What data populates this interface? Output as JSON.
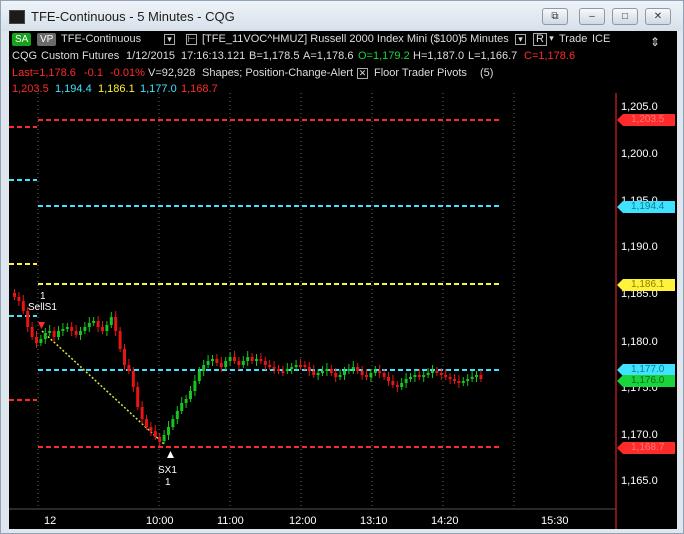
{
  "window": {
    "title": "TFE-Continuous - 5 Minutes - CQG",
    "buttons": [
      "⧉",
      "–",
      "□",
      "✕"
    ]
  },
  "toolbar": {
    "sa": "SA",
    "vp": "VP",
    "symbol": "TFE-Continuous",
    "contract": "[TFE_11VOC^HMUZ] Russell 2000 Index Mini ($100)",
    "interval": "5 Minutes",
    "r_button": "R",
    "trade": "Trade",
    "exchange": "ICE"
  },
  "quote": {
    "source": "CQG",
    "account": "Custom Futures",
    "date": "1/12/2015",
    "time": "17:16:13.121",
    "bid": "B=1,178.5",
    "ask": "A=1,178.6",
    "open": "O=1,179.2",
    "high": "H=1,187.0",
    "low": "L=1,166.7",
    "close": "C=1,178.6",
    "last": "Last=1,178.6",
    "change": "-0.1",
    "change_pct": "-0.01%",
    "volume": "V=92,928",
    "shapes": "Shapes; Position-Change-Alert",
    "study": "Floor Trader Pivots",
    "study_param": "(5)"
  },
  "pivots": {
    "r2": "1,203.5",
    "r1": "1,194.4",
    "pp": "1,186.1",
    "s1": "1,177.0",
    "s2": "1,168.7"
  },
  "colors": {
    "red": "#ff2a2a",
    "cyan": "#3fe3ff",
    "yellow": "#fff23a",
    "green": "#19d43a",
    "up": "#16c51e",
    "down": "#e81515"
  },
  "axis": {
    "y_ticks": [
      "1,205.0",
      "1,200.0",
      "1,195.0",
      "1,190.0",
      "1,185.0",
      "1,180.0",
      "1,175.0",
      "1,170.0",
      "1,165.0"
    ],
    "x_ticks": [
      "12",
      "10:00",
      "11:00",
      "12:00",
      "13:10",
      "14:20",
      "15:30"
    ]
  },
  "price_badges": {
    "r2": "1,203.5",
    "r1": "1,194.4",
    "pp": "1,186.1",
    "s1": "1,177.0",
    "last": "1,176.0",
    "s2": "1,168.7"
  },
  "annotations": {
    "sell_label": "SellS1",
    "sell_qty": "1",
    "exit_label": "SX1",
    "exit_qty": "1"
  }
}
